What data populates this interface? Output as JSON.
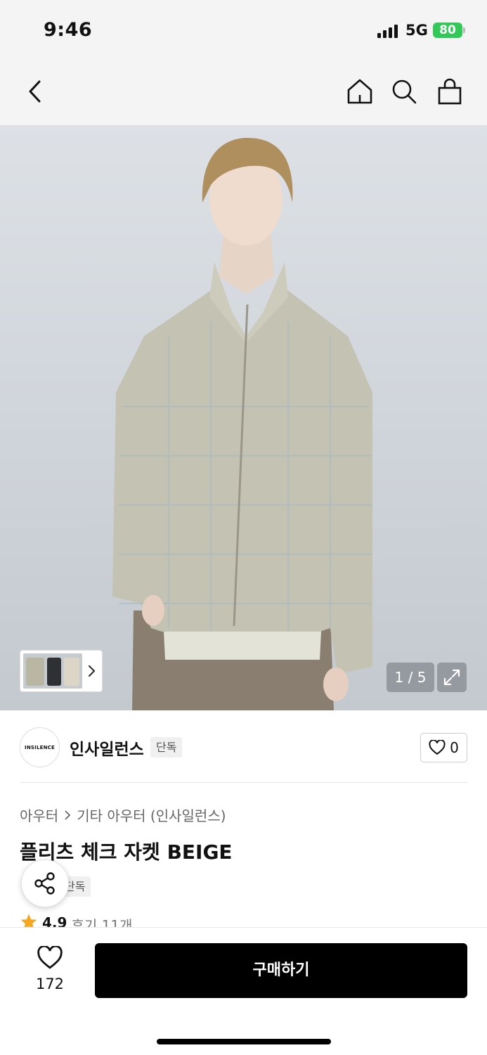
{
  "status_bar": {
    "time": "9:46",
    "network": "5G",
    "battery": "80"
  },
  "nav": {
    "back_icon": "chevron-left-icon",
    "home_icon": "home-icon",
    "search_icon": "search-icon",
    "cart_icon": "shopping-bag-icon"
  },
  "gallery": {
    "pager": "1 / 5",
    "thumb_arrow_icon": "chevron-right-icon",
    "expand_icon": "expand-icon"
  },
  "brand": {
    "logo_text": "INSILENCE",
    "name": "인사일런스",
    "badge": "단독",
    "like_count": "0"
  },
  "product": {
    "breadcrumb": [
      "아우터",
      "기타 아우터 (인사일런스)"
    ],
    "title": "플리츠 체크 자켓 BEIGE",
    "badge": "단독",
    "rating": "4.9",
    "reviews": "후기 11개"
  },
  "bottom_bar": {
    "wish_count": "172",
    "buy_label": "구매하기"
  },
  "colors": {
    "accent_star": "#f5a623",
    "battery": "#34c759",
    "buy_button": "#000000"
  }
}
